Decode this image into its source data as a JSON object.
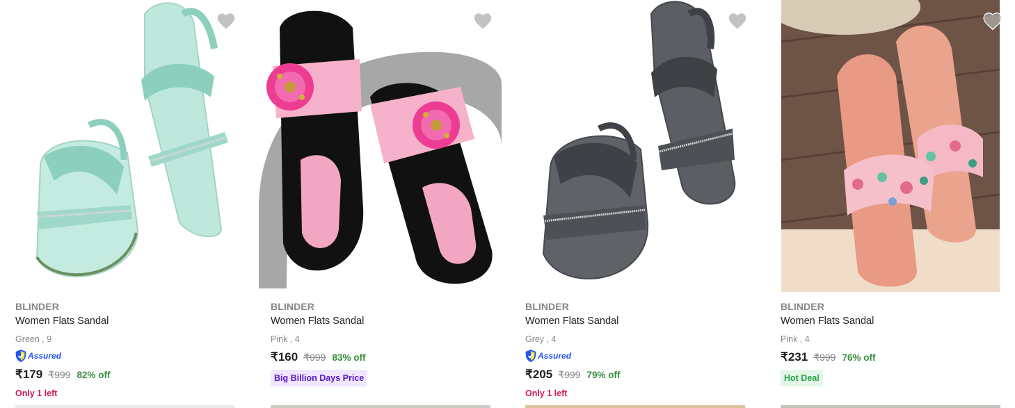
{
  "products": [
    {
      "brand": "BLINDER",
      "title": "Women Flats Sandal",
      "variant": "Green , 9",
      "assured_label": "Assured",
      "price": "₹179",
      "mrp": "₹999",
      "discount": "82% off",
      "stock_note": "Only 1 left"
    },
    {
      "brand": "BLINDER",
      "title": "Women Flats Sandal",
      "variant": "Pink , 4",
      "price": "₹160",
      "mrp": "₹999",
      "discount": "83% off",
      "badge": "Big Billion Days Price"
    },
    {
      "brand": "BLINDER",
      "title": "Women Flats Sandal",
      "variant": "Grey , 4",
      "assured_label": "Assured",
      "price": "₹205",
      "mrp": "₹999",
      "discount": "79% off",
      "stock_note": "Only 1 left"
    },
    {
      "brand": "BLINDER",
      "title": "Women Flats Sandal",
      "variant": "Pink , 4",
      "price": "₹231",
      "mrp": "₹999",
      "discount": "76% off",
      "badge": "Hot Deal"
    }
  ],
  "icons": {
    "wishlist": "heart-icon",
    "assured": "shield-check-icon"
  },
  "colors": {
    "discount": "#388e3c",
    "stock_note": "#d4145a",
    "assured": "#2455f4",
    "brand_text": "#878787",
    "wishlist_heart": "#c2c2c2"
  }
}
